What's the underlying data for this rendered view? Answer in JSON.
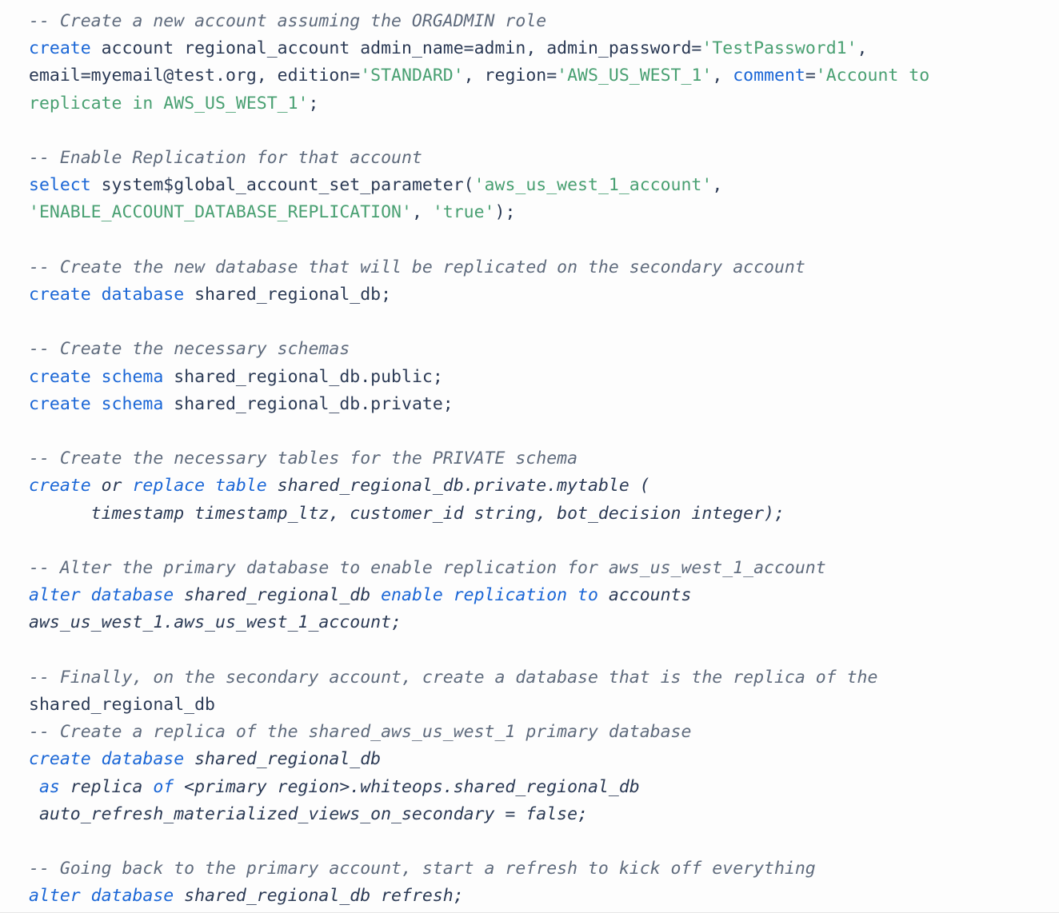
{
  "code_block": {
    "language": "sql",
    "background_color": "#fdfdfd",
    "colors": {
      "plain": "#2b3a55",
      "keyword": "#1a66d6",
      "string": "#49a072",
      "comment": "#5f6b7d"
    },
    "lines": [
      {
        "id": "l1",
        "kind": "comment",
        "text": "-- Create a new account assuming the ORGADMIN role"
      },
      {
        "id": "l2",
        "kind": "code",
        "tokens": [
          {
            "t": "create",
            "c": "keyword"
          },
          {
            "t": " account regional_account admin_name=admin, admin_password=",
            "c": "plain"
          },
          {
            "t": "'TestPassword1'",
            "c": "string"
          },
          {
            "t": ",",
            "c": "punct"
          }
        ]
      },
      {
        "id": "l3",
        "kind": "code",
        "tokens": [
          {
            "t": "email=myemail@test.org, edition=",
            "c": "plain"
          },
          {
            "t": "'STANDARD'",
            "c": "string"
          },
          {
            "t": ", region=",
            "c": "plain"
          },
          {
            "t": "'AWS_US_WEST_1'",
            "c": "string"
          },
          {
            "t": ", ",
            "c": "plain"
          },
          {
            "t": "comment",
            "c": "keyword"
          },
          {
            "t": "=",
            "c": "plain"
          },
          {
            "t": "'Account to",
            "c": "string"
          }
        ]
      },
      {
        "id": "l4",
        "kind": "code",
        "tokens": [
          {
            "t": "replicate in AWS_US_WEST_1'",
            "c": "string"
          },
          {
            "t": ";",
            "c": "punct"
          }
        ]
      },
      {
        "id": "l5",
        "kind": "blank",
        "text": ""
      },
      {
        "id": "l6",
        "kind": "comment",
        "text": "-- Enable Replication for that account"
      },
      {
        "id": "l7",
        "kind": "code",
        "tokens": [
          {
            "t": "select",
            "c": "keyword"
          },
          {
            "t": " system$global_account_set_parameter(",
            "c": "plain"
          },
          {
            "t": "'aws_us_west_1_account'",
            "c": "string"
          },
          {
            "t": ",",
            "c": "punct"
          }
        ]
      },
      {
        "id": "l8",
        "kind": "code",
        "tokens": [
          {
            "t": "'ENABLE_ACCOUNT_DATABASE_REPLICATION'",
            "c": "string"
          },
          {
            "t": ", ",
            "c": "plain"
          },
          {
            "t": "'true'",
            "c": "string"
          },
          {
            "t": ");",
            "c": "punct"
          }
        ]
      },
      {
        "id": "l9",
        "kind": "blank",
        "text": ""
      },
      {
        "id": "l10",
        "kind": "comment",
        "text": "-- Create the new database that will be replicated on the secondary account"
      },
      {
        "id": "l11",
        "kind": "code",
        "tokens": [
          {
            "t": "create database",
            "c": "keyword"
          },
          {
            "t": " shared_regional_db;",
            "c": "plain"
          }
        ]
      },
      {
        "id": "l12",
        "kind": "blank",
        "text": ""
      },
      {
        "id": "l13",
        "kind": "comment",
        "text": "-- Create the necessary schemas"
      },
      {
        "id": "l14",
        "kind": "code",
        "tokens": [
          {
            "t": "create schema",
            "c": "keyword"
          },
          {
            "t": " shared_regional_db.public;",
            "c": "plain"
          }
        ]
      },
      {
        "id": "l15",
        "kind": "code",
        "tokens": [
          {
            "t": "create schema",
            "c": "keyword"
          },
          {
            "t": " shared_regional_db.private;",
            "c": "plain"
          }
        ]
      },
      {
        "id": "l16",
        "kind": "blank",
        "text": ""
      },
      {
        "id": "l17",
        "kind": "comment",
        "text": "-- Create the necessary tables for the PRIVATE schema"
      },
      {
        "id": "l18",
        "kind": "code",
        "italic": true,
        "tokens": [
          {
            "t": "create",
            "c": "keyword"
          },
          {
            "t": " or ",
            "c": "plain"
          },
          {
            "t": "replace table",
            "c": "keyword"
          },
          {
            "t": " shared_regional_db.private.mytable (",
            "c": "plain"
          }
        ]
      },
      {
        "id": "l19",
        "kind": "code",
        "italic": true,
        "indent": 6,
        "tokens": [
          {
            "t": "timestamp timestamp_ltz, customer_id string, bot_decision integer);",
            "c": "plain"
          }
        ]
      },
      {
        "id": "l20",
        "kind": "blank",
        "text": ""
      },
      {
        "id": "l21",
        "kind": "comment",
        "text": "-- Alter the primary database to enable replication for aws_us_west_1_account"
      },
      {
        "id": "l22",
        "kind": "code",
        "italic": true,
        "tokens": [
          {
            "t": "alter database",
            "c": "keyword"
          },
          {
            "t": " shared_regional_db ",
            "c": "plain"
          },
          {
            "t": "enable replication to",
            "c": "keyword"
          },
          {
            "t": " accounts",
            "c": "plain"
          }
        ]
      },
      {
        "id": "l23",
        "kind": "code",
        "italic": true,
        "tokens": [
          {
            "t": "aws_us_west_1.aws_us_west_1_account;",
            "c": "plain"
          }
        ]
      },
      {
        "id": "l24",
        "kind": "blank",
        "text": ""
      },
      {
        "id": "l25",
        "kind": "comment",
        "text": "-- Finally, on the secondary account, create a database that is the replica of the"
      },
      {
        "id": "l26",
        "kind": "code",
        "tokens": [
          {
            "t": "shared_regional_db",
            "c": "plain"
          }
        ]
      },
      {
        "id": "l27",
        "kind": "comment",
        "text": "-- Create a replica of the shared_aws_us_west_1 primary database"
      },
      {
        "id": "l28",
        "kind": "code",
        "italic": true,
        "tokens": [
          {
            "t": "create database",
            "c": "keyword"
          },
          {
            "t": " shared_regional_db",
            "c": "plain"
          }
        ]
      },
      {
        "id": "l29",
        "kind": "code",
        "italic": true,
        "indent": 1,
        "tokens": [
          {
            "t": "as",
            "c": "keyword"
          },
          {
            "t": " replica ",
            "c": "plain"
          },
          {
            "t": "of",
            "c": "keyword"
          },
          {
            "t": " <primary region>.whiteops.shared_regional_db",
            "c": "plain"
          }
        ]
      },
      {
        "id": "l30",
        "kind": "code",
        "italic": true,
        "indent": 1,
        "tokens": [
          {
            "t": "auto_refresh_materialized_views_on_secondary = false;",
            "c": "plain"
          }
        ]
      },
      {
        "id": "l31",
        "kind": "blank",
        "text": ""
      },
      {
        "id": "l32",
        "kind": "comment",
        "text": "-- Going back to the primary account, start a refresh to kick off everything"
      },
      {
        "id": "l33",
        "kind": "code",
        "italic": true,
        "tokens": [
          {
            "t": "alter database",
            "c": "keyword"
          },
          {
            "t": " shared_regional_db ",
            "c": "plain"
          },
          {
            "t": "refresh;",
            "c": "plain"
          }
        ]
      }
    ]
  }
}
